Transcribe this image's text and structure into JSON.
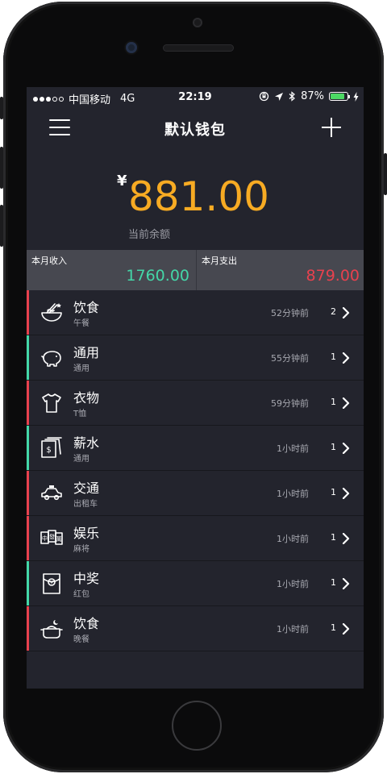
{
  "status_bar": {
    "carrier": "中国移动",
    "network": "4G",
    "time": "22:19",
    "battery": "87%",
    "battery_level": 0.87
  },
  "nav": {
    "title": "默认钱包",
    "menu_icon": "hamburger-menu-icon",
    "add_icon": "plus-icon"
  },
  "balance": {
    "currency_symbol": "¥",
    "amount": "881.00",
    "label": "当前余额"
  },
  "summary": {
    "income_label": "本月收入",
    "income_value": "1760.00",
    "expense_label": "本月支出",
    "expense_value": "879.00"
  },
  "colors": {
    "income": "#44d7a8",
    "expense": "#e8414e",
    "balance": "#f7ab23"
  },
  "records": [
    {
      "title": "饮食",
      "sub": "午餐",
      "time": "52分钟前",
      "count": "2",
      "type": "expense",
      "icon": "noodle-bowl-icon"
    },
    {
      "title": "通用",
      "sub": "通用",
      "time": "55分钟前",
      "count": "1",
      "type": "income",
      "icon": "piggy-bank-icon"
    },
    {
      "title": "衣物",
      "sub": "T恤",
      "time": "59分钟前",
      "count": "1",
      "type": "expense",
      "icon": "tshirt-icon"
    },
    {
      "title": "薪水",
      "sub": "通用",
      "time": "1小时前",
      "count": "1",
      "type": "income",
      "icon": "cash-stack-icon"
    },
    {
      "title": "交通",
      "sub": "出租车",
      "time": "1小时前",
      "count": "1",
      "type": "expense",
      "icon": "taxi-icon"
    },
    {
      "title": "娱乐",
      "sub": "麻将",
      "time": "1小时前",
      "count": "1",
      "type": "expense",
      "icon": "mahjong-icon"
    },
    {
      "title": "中奖",
      "sub": "红包",
      "time": "1小时前",
      "count": "1",
      "type": "income",
      "icon": "red-envelope-icon"
    },
    {
      "title": "饮食",
      "sub": "晚餐",
      "time": "1小时前",
      "count": "1",
      "type": "expense",
      "icon": "dinner-pot-icon"
    }
  ]
}
